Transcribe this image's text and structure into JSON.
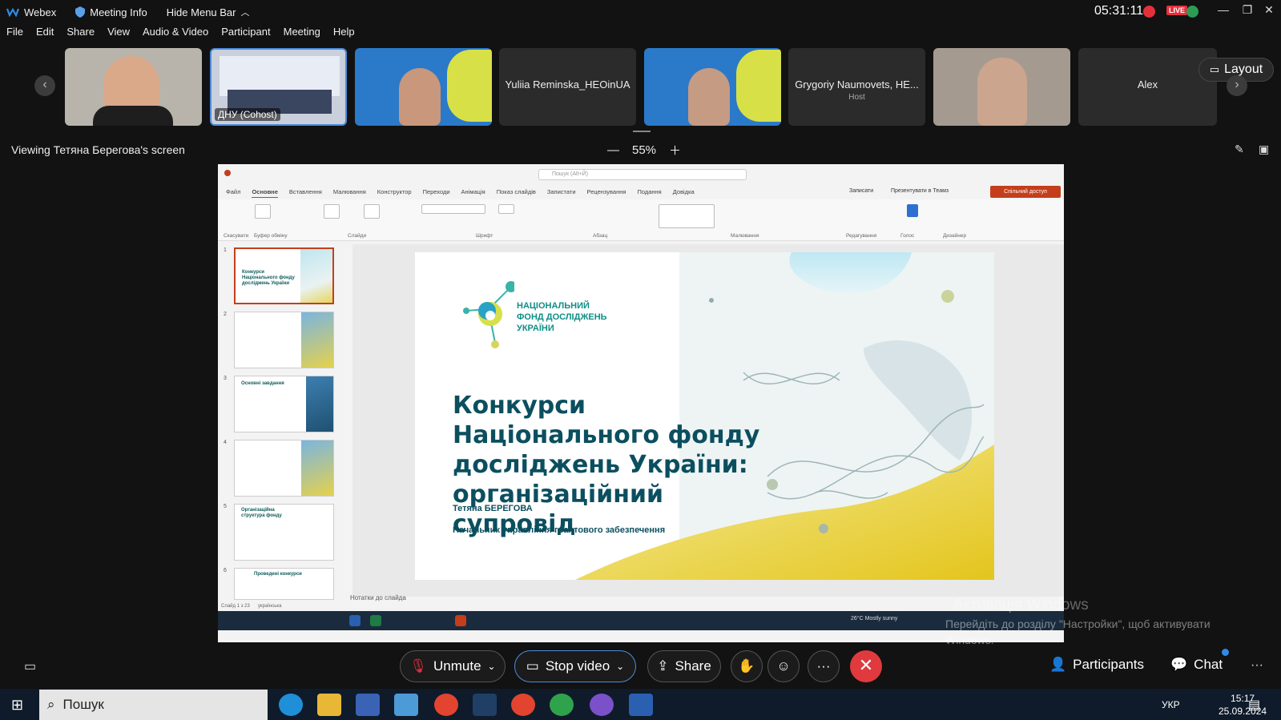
{
  "titlebar": {
    "app_name": "Webex",
    "meeting_info": "Meeting Info",
    "hide_menu_bar": "Hide Menu Bar",
    "clock": "05:31:11",
    "live_label": "LIVE"
  },
  "menu": [
    "File",
    "Edit",
    "Share",
    "View",
    "Audio & Video",
    "Participant",
    "Meeting",
    "Help"
  ],
  "participants": [
    {
      "name": "",
      "sub": "",
      "label": ""
    },
    {
      "name": "",
      "sub": "",
      "label": "ДНУ (Cohost)"
    },
    {
      "name": "",
      "sub": "",
      "label": ""
    },
    {
      "name": "Yuliia Reminska_HEOinUA",
      "sub": "",
      "label": ""
    },
    {
      "name": "",
      "sub": "",
      "label": ""
    },
    {
      "name": "Grygoriy Naumovets, HE...",
      "sub": "Host",
      "label": ""
    },
    {
      "name": "",
      "sub": "",
      "label": ""
    },
    {
      "name": "Alex",
      "sub": "",
      "label": ""
    }
  ],
  "layout_label": "Layout",
  "viewing": {
    "label": "Viewing Тетяна Берегова's screen",
    "zoom": "55%"
  },
  "ppt": {
    "search_placeholder": "Пошук (Alt+Й)",
    "tabs": [
      "Файл",
      "Основне",
      "Вставлення",
      "Малювання",
      "Конструктор",
      "Переходи",
      "Анімація",
      "Показ слайдів",
      "Запистати",
      "Рецензування",
      "Подання",
      "Довідка"
    ],
    "record_label": "Записати",
    "present_label": "Презентувати в Теамз",
    "share_label": "Спільний доступ",
    "ribbon_groups": [
      "Скасувати",
      "Буфер обміну",
      "Слайди",
      "Шрифт",
      "Абзац",
      "Малювання",
      "Редагування",
      "Голос",
      "Дизайнер"
    ],
    "notes_label": "Нотатки до слайда",
    "status_left": "Слайд 1 з 23",
    "status_lang": "українська",
    "thumb_numbers": [
      "1",
      "2",
      "3",
      "4",
      "5",
      "6"
    ],
    "thumb_titles": [
      "Конкурси Національного фонду досліджень України",
      "",
      "Основні завдання",
      "",
      "Організаційна структура фонду",
      "Проведені конкурси"
    ],
    "weather": "26°C  Mostly sunny"
  },
  "slide": {
    "logo_text": "НАЦІОНАЛЬНИЙ\nФОНД ДОСЛІДЖЕНЬ\nУКРАЇНИ",
    "title": "Конкурси Національного фонду досліджень України: організаційний супровід",
    "author": "Тетяна БЕРЕГОВА",
    "position": "Начальник управління грантового забезпечення"
  },
  "windows_activation": {
    "line1": "Активація Windows",
    "line2": "Перейдіть до розділу \"Настройки\", щоб активувати Windows."
  },
  "controls": {
    "unmute": "Unmute",
    "stop_video": "Stop video",
    "share": "Share",
    "participants": "Participants",
    "chat": "Chat"
  },
  "taskbar": {
    "search": "Пошук",
    "lang": "УКР",
    "time": "15:17",
    "date": "25.09.2024"
  },
  "colors": {
    "accent_red": "#e03a3e",
    "ppt_red": "#c43e1c",
    "slide_teal": "#0b4f5f"
  }
}
